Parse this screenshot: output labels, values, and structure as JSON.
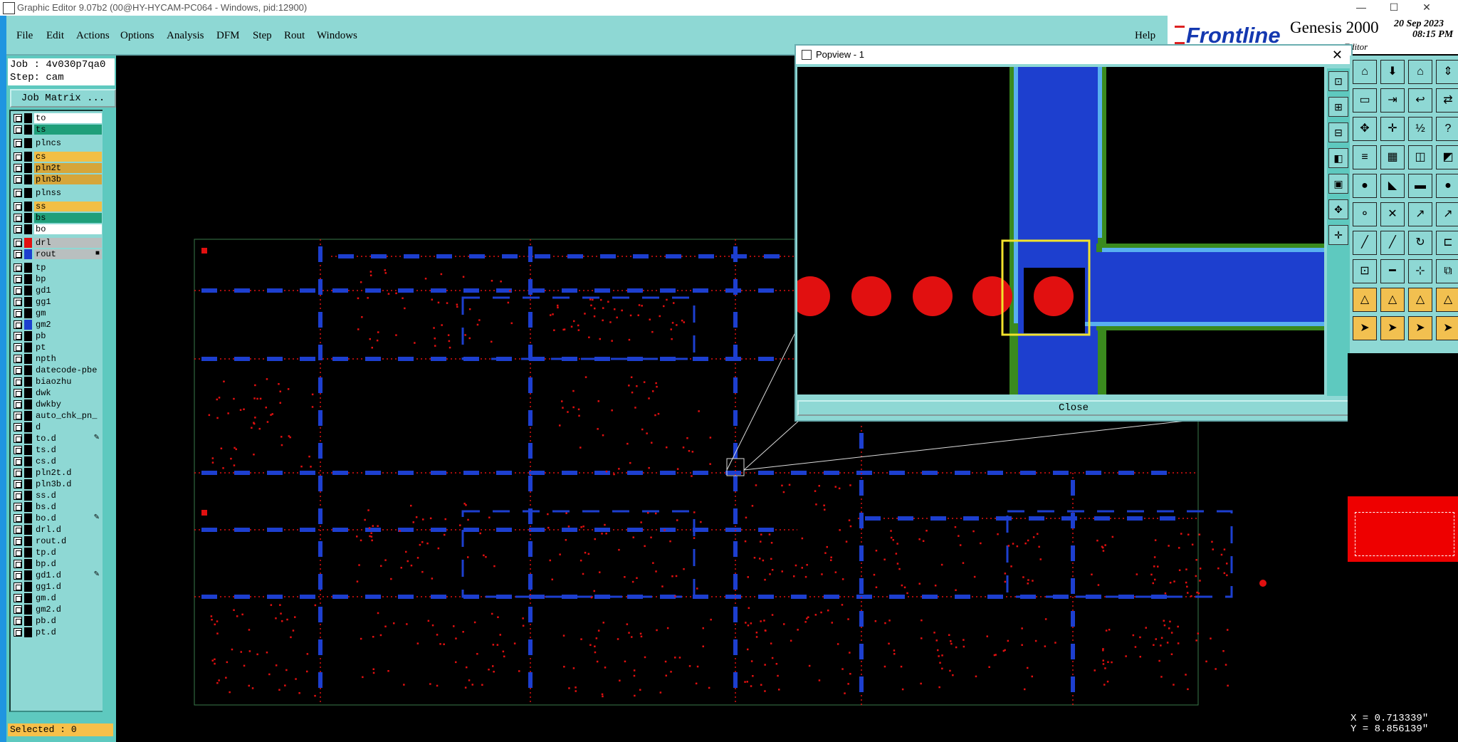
{
  "window": {
    "title": "Graphic Editor 9.07b2 (00@HY-HYCAM-PC064 - Windows, pid:12900)",
    "controls": {
      "minimize": "—",
      "maximize": "☐",
      "close": "✕"
    }
  },
  "menu": {
    "items": [
      "File",
      "Edit",
      "Actions",
      "Options",
      "Analysis",
      "DFM",
      "Step",
      "Rout",
      "Windows"
    ],
    "help": "Help"
  },
  "brand": {
    "frontline": "Frontline",
    "genesis": "Genesis 2000",
    "editor": "Editor",
    "date": "20 Sep 2023",
    "time": "08:15 PM"
  },
  "job": {
    "job_line": "Job : 4v030p7qa0",
    "step_line": "Step: cam",
    "matrix_button": "Job Matrix ..."
  },
  "layers": [
    {
      "name": "to",
      "bg": "#ffffff",
      "swatch": ""
    },
    {
      "name": "ts",
      "bg": "#1f9f7a",
      "swatch": ""
    },
    {
      "name": "plncs",
      "bg": "#8ed8d4",
      "swatch": "",
      "gap": true
    },
    {
      "name": "cs",
      "bg": "#f2bf45",
      "swatch": "",
      "gap": true
    },
    {
      "name": "pln2t",
      "bg": "#d6a63a",
      "swatch": ""
    },
    {
      "name": "pln3b",
      "bg": "#d6a63a",
      "swatch": ""
    },
    {
      "name": "plnss",
      "bg": "#8ed8d4",
      "swatch": "",
      "gap": true
    },
    {
      "name": "ss",
      "bg": "#f2bf45",
      "swatch": "",
      "gap": true
    },
    {
      "name": "bs",
      "bg": "#1f9f7a",
      "swatch": ""
    },
    {
      "name": "bo",
      "bg": "#ffffff",
      "swatch": ""
    },
    {
      "name": "drl",
      "bg": "#b9bfbf",
      "swatch": "#e11010",
      "gap": true
    },
    {
      "name": "rout",
      "bg": "#b9bfbf",
      "swatch": "#1d3fcf",
      "mark": "■"
    },
    {
      "name": "tp",
      "bg": "#8ed8d4",
      "swatch": "",
      "gap": true
    },
    {
      "name": "bp",
      "bg": "#8ed8d4",
      "swatch": ""
    },
    {
      "name": "gd1",
      "bg": "#8ed8d4",
      "swatch": ""
    },
    {
      "name": "gg1",
      "bg": "#8ed8d4",
      "swatch": ""
    },
    {
      "name": "gm",
      "bg": "#8ed8d4",
      "swatch": ""
    },
    {
      "name": "gm2",
      "bg": "#8ed8d4",
      "swatch": "#1d3fcf"
    },
    {
      "name": "pb",
      "bg": "#8ed8d4",
      "swatch": ""
    },
    {
      "name": "pt",
      "bg": "#8ed8d4",
      "swatch": ""
    },
    {
      "name": "npth",
      "bg": "#8ed8d4",
      "swatch": ""
    },
    {
      "name": "datecode-pbe",
      "bg": "#8ed8d4",
      "swatch": ""
    },
    {
      "name": "biaozhu",
      "bg": "#8ed8d4",
      "swatch": ""
    },
    {
      "name": "dwk",
      "bg": "#8ed8d4",
      "swatch": ""
    },
    {
      "name": "dwkby",
      "bg": "#8ed8d4",
      "swatch": ""
    },
    {
      "name": "auto_chk_pn_",
      "bg": "#8ed8d4",
      "swatch": ""
    },
    {
      "name": "d",
      "bg": "#8ed8d4",
      "swatch": ""
    },
    {
      "name": "to.d",
      "bg": "#8ed8d4",
      "swatch": "",
      "mark": "✎"
    },
    {
      "name": "ts.d",
      "bg": "#8ed8d4",
      "swatch": ""
    },
    {
      "name": "cs.d",
      "bg": "#8ed8d4",
      "swatch": ""
    },
    {
      "name": "pln2t.d",
      "bg": "#8ed8d4",
      "swatch": ""
    },
    {
      "name": "pln3b.d",
      "bg": "#8ed8d4",
      "swatch": ""
    },
    {
      "name": "ss.d",
      "bg": "#8ed8d4",
      "swatch": ""
    },
    {
      "name": "bs.d",
      "bg": "#8ed8d4",
      "swatch": ""
    },
    {
      "name": "bo.d",
      "bg": "#8ed8d4",
      "swatch": "",
      "mark": "✎"
    },
    {
      "name": "drl.d",
      "bg": "#8ed8d4",
      "swatch": ""
    },
    {
      "name": "rout.d",
      "bg": "#8ed8d4",
      "swatch": ""
    },
    {
      "name": "tp.d",
      "bg": "#8ed8d4",
      "swatch": ""
    },
    {
      "name": "bp.d",
      "bg": "#8ed8d4",
      "swatch": ""
    },
    {
      "name": "gd1.d",
      "bg": "#8ed8d4",
      "swatch": "",
      "mark": "✎"
    },
    {
      "name": "gg1.d",
      "bg": "#8ed8d4",
      "swatch": ""
    },
    {
      "name": "gm.d",
      "bg": "#8ed8d4",
      "swatch": ""
    },
    {
      "name": "gm2.d",
      "bg": "#8ed8d4",
      "swatch": ""
    },
    {
      "name": "pb.d",
      "bg": "#8ed8d4",
      "swatch": ""
    },
    {
      "name": "pt.d",
      "bg": "#8ed8d4",
      "swatch": ""
    }
  ],
  "status": {
    "selected": "Selected : 0"
  },
  "popview": {
    "title": "Popview - 1",
    "close_button": "Close",
    "close_x": "✕"
  },
  "coords": {
    "x": "X = 0.713339\"",
    "y": "Y = 8.856139\""
  },
  "colors": {
    "panel": "#8ed8d4",
    "panel_dark": "#5ec9bf",
    "drill": "#e11010",
    "rout": "#1d3fcf",
    "highlight": "#f2e32b"
  }
}
